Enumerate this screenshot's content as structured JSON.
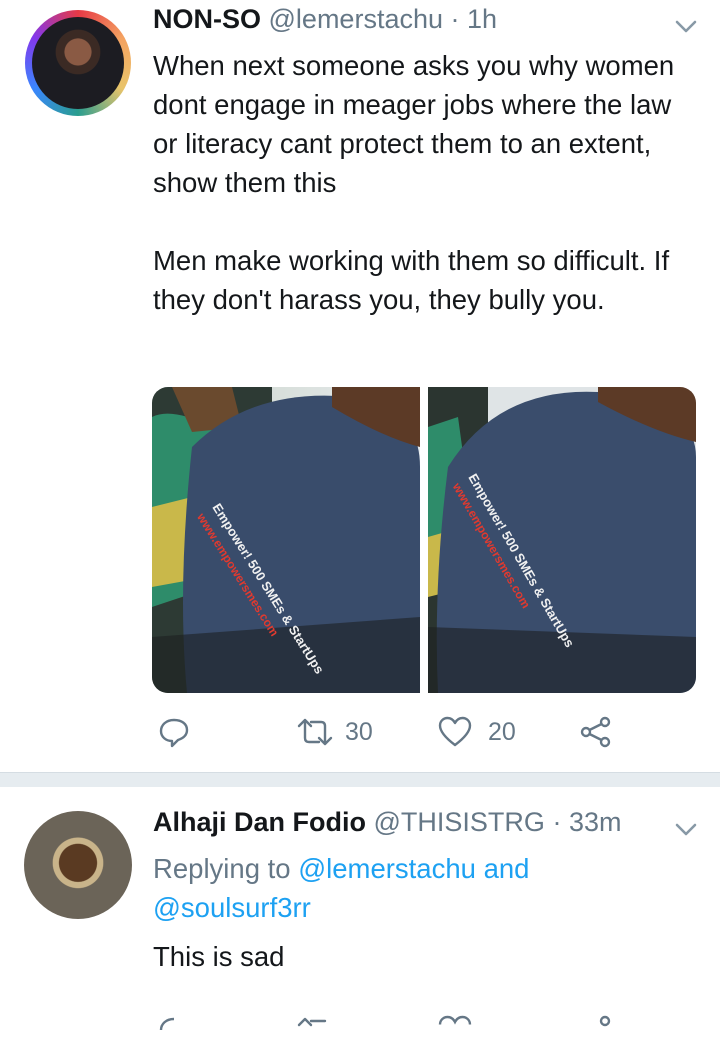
{
  "tweet1": {
    "name": "NON-SO",
    "handle": "@lemerstachu",
    "separator": "·",
    "time": "1h",
    "text_p1": "When next someone asks you why women dont engage in meager jobs where the law or literacy  cant protect them to an extent, show them this",
    "text_p2": "Men make working with them so difficult. If they don't harass you, they bully you.",
    "media": [
      {
        "shirt_text": "Empower! 500 SMEs & StartUps",
        "url_text": "www.empowersmes.com"
      },
      {
        "shirt_text": "Empower! 500 SMEs & StartUps",
        "url_text": "www.empowersmes.com"
      }
    ],
    "retweets": "30",
    "likes": "20"
  },
  "tweet2": {
    "name": "Alhaji Dan Fodio",
    "handle": "@THISISTRG",
    "separator": "·",
    "time": "33m",
    "replying_prefix": "Replying to",
    "replying_user1": "@lemerstachu",
    "replying_and": "and",
    "replying_user2": "@soulsurf3rr",
    "text": "This is sad"
  },
  "colors": {
    "text": "#14171a",
    "secondary": "#657786",
    "link": "#1da1f2",
    "divider": "#e6ecf0"
  },
  "icons": [
    "chevron-down-icon",
    "reply-icon",
    "retweet-icon",
    "like-icon",
    "share-icon"
  ]
}
